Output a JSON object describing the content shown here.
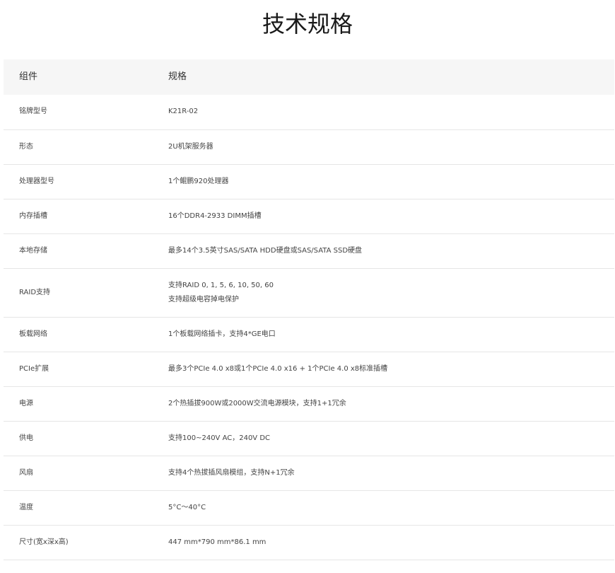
{
  "title": "技术规格",
  "header": {
    "component": "组件",
    "spec": "规格"
  },
  "rows": [
    {
      "component": "铭牌型号",
      "spec": [
        "K21R-02"
      ]
    },
    {
      "component": "形态",
      "spec": [
        "2U机架服务器"
      ]
    },
    {
      "component": "处理器型号",
      "spec": [
        "1个鲲鹏920处理器"
      ]
    },
    {
      "component": "内存插槽",
      "spec": [
        "16个DDR4-2933 DIMM插槽"
      ]
    },
    {
      "component": "本地存储",
      "spec": [
        "最多14个3.5英寸SAS/SATA HDD硬盘或SAS/SATA SSD硬盘"
      ]
    },
    {
      "component": "RAID支持",
      "spec": [
        "支持RAID 0, 1, 5, 6, 10, 50, 60",
        "支持超级电容掉电保护"
      ]
    },
    {
      "component": "板载网络",
      "spec": [
        "1个板载网络插卡，支持4*GE电口"
      ]
    },
    {
      "component": "PCIe扩展",
      "spec": [
        "最多3个PCIe 4.0 x8或1个PCIe 4.0 x16 + 1个PCIe 4.0 x8标准插槽"
      ]
    },
    {
      "component": "电源",
      "spec": [
        "2个热插拔900W或2000W交流电源模块，支持1+1冗余"
      ]
    },
    {
      "component": "供电",
      "spec": [
        "支持100~240V AC，240V DC"
      ]
    },
    {
      "component": "风扇",
      "spec": [
        "支持4个热拔插风扇模组，支持N+1冗余"
      ]
    },
    {
      "component": "温度",
      "spec": [
        "5°C～40°C"
      ]
    },
    {
      "component": "尺寸(宽x深x高)",
      "spec": [
        "447 mm*790 mm*86.1 mm"
      ]
    }
  ]
}
